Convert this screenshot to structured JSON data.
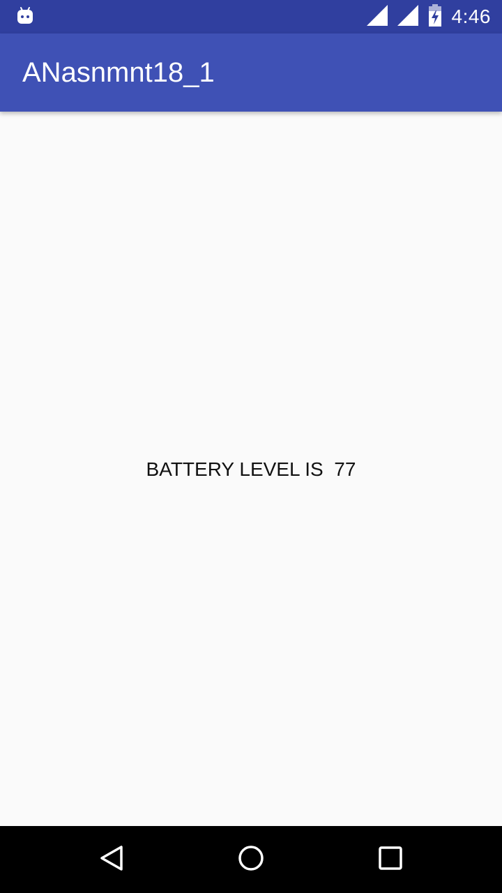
{
  "status_bar": {
    "time": "4:46",
    "icons": [
      "android-debug-icon",
      "signal-icon",
      "signal-icon",
      "battery-charging-icon"
    ],
    "background_color": "#303f9f"
  },
  "app_bar": {
    "title": "ANasnmnt18_1",
    "background_color": "#3f51b5"
  },
  "main": {
    "battery_text": "BATTERY LEVEL IS  77"
  },
  "nav_bar": {
    "buttons": [
      "back-icon",
      "home-icon",
      "recents-icon"
    ],
    "background_color": "#000000"
  }
}
